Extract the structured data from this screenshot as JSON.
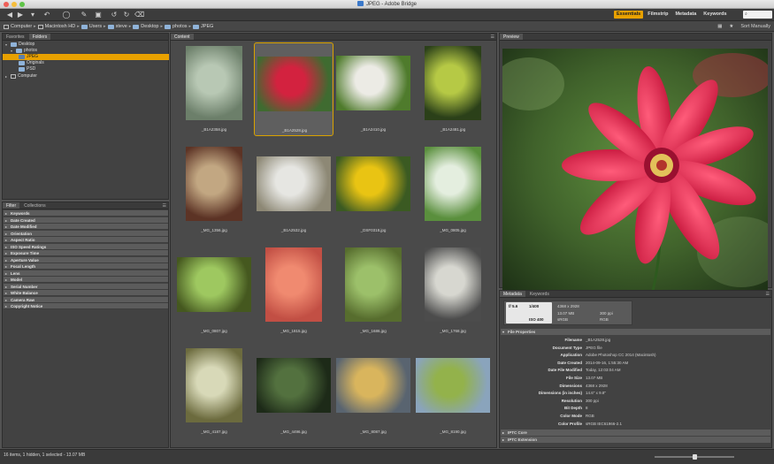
{
  "window": {
    "title": "JPEG - Adobe Bridge"
  },
  "toolbar": {
    "workspaces": [
      "Essentials",
      "Filmstrip",
      "Metadata",
      "Keywords"
    ],
    "search_value": "⌕"
  },
  "path": {
    "crumbs": [
      "Computer",
      "Macintosh HD",
      "Users",
      "steve",
      "Desktop",
      "photos",
      "JPEG"
    ],
    "sort_label": "Sort Manually"
  },
  "left_top_panel": {
    "tabs": [
      "Favorites",
      "Folders"
    ],
    "tree": [
      {
        "label": "Desktop",
        "level": 0
      },
      {
        "label": "photos",
        "level": 1
      },
      {
        "label": "JPEG",
        "level": 2
      },
      {
        "label": "Originals",
        "level": 2
      },
      {
        "label": "PSD",
        "level": 2
      },
      {
        "label": "Computer",
        "level": 0
      }
    ],
    "selected": "JPEG"
  },
  "filter_panel": {
    "tabs": [
      "Filter",
      "Collections"
    ],
    "rows": [
      "Keywords",
      "Date Created",
      "Date Modified",
      "Orientation",
      "Aspect Ratio",
      "ISO Speed Ratings",
      "Exposure Time",
      "Aperture Value",
      "Focal Length",
      "Lens",
      "Model",
      "Serial Number",
      "White Balance",
      "Camera Raw",
      "Copyright Notice"
    ]
  },
  "content_panel": {
    "tab": "Content",
    "thumbnails": [
      {
        "name": "_B1A2358.jpg",
        "colors": [
          "#b8c8b4",
          "#6c7f6a"
        ]
      },
      {
        "name": "_B1A2528.jpg",
        "colors": [
          "#d3223f",
          "#3f6b30"
        ]
      },
      {
        "name": "_B1A2410.jpg",
        "colors": [
          "#ecebe5",
          "#4f7b2c"
        ]
      },
      {
        "name": "_B1A2481.jpg",
        "colors": [
          "#b6c945",
          "#2b4019"
        ]
      },
      {
        "name": "_MG_1356.jpg",
        "colors": [
          "#c2a782",
          "#5c3325"
        ]
      },
      {
        "name": "_B1A2532.jpg",
        "colors": [
          "#e6e6e2",
          "#8d8875"
        ]
      },
      {
        "name": "_DSF0318.jpg",
        "colors": [
          "#e9c413",
          "#3b5a22"
        ]
      },
      {
        "name": "_MG_0805.jpg",
        "colors": [
          "#e4eedf",
          "#5a8f3d"
        ]
      },
      {
        "name": "_MG_0807.jpg",
        "colors": [
          "#9ec860",
          "#45581f"
        ]
      },
      {
        "name": "_MG_1815.jpg",
        "colors": [
          "#f08a70",
          "#c24f44"
        ]
      },
      {
        "name": "_MG_1686.jpg",
        "colors": [
          "#9cc06a",
          "#576d2e"
        ]
      },
      {
        "name": "_MG_1768.jpg",
        "colors": [
          "#d7d7d0",
          "#4c4c4c"
        ]
      },
      {
        "name": "_MG_4187.jpg",
        "colors": [
          "#d8d9b8",
          "#6c6b3e"
        ]
      },
      {
        "name": "_MG_4496.jpg",
        "colors": [
          "#53713f",
          "#1d2a18"
        ]
      },
      {
        "name": "_MG_8087.jpg",
        "colors": [
          "#d9b55d",
          "#596470"
        ]
      },
      {
        "name": "_MG_8190.jpg",
        "colors": [
          "#93b24b",
          "#8aa4bc"
        ]
      }
    ],
    "selected_index": 1
  },
  "preview_panel": {
    "tab": "Preview",
    "filename": "_B1A2528.jpg"
  },
  "metadata_panel": {
    "tabs": [
      "Metadata",
      "Keywords"
    ],
    "camera": {
      "aperture": "f/ 5.6",
      "shutter": "1/400",
      "iso": "ISO 400",
      "dimensions": "4368 x 2928",
      "size": "13.07 MB",
      "resolution": "300 ppi",
      "color_mode": "sRGB",
      "color": "RGB"
    },
    "section_file": "File Properties",
    "properties": [
      {
        "key": "Filename",
        "value": "_B1A2528.jpg"
      },
      {
        "key": "Document Type",
        "value": "JPEG file"
      },
      {
        "key": "Application",
        "value": "Adobe Photoshop CC 2014 (Macintosh)"
      },
      {
        "key": "Date Created",
        "value": "2014-09-16, 1:55:30 AM"
      },
      {
        "key": "Date File Modified",
        "value": "Today, 12:03:04 AM"
      },
      {
        "key": "File Size",
        "value": "13.07 MB"
      },
      {
        "key": "Dimensions",
        "value": "4368 x 2928"
      },
      {
        "key": "Dimensions (in inches)",
        "value": "14.6\" x 9.8\""
      },
      {
        "key": "Resolution",
        "value": "300 ppi"
      },
      {
        "key": "Bit Depth",
        "value": "8"
      },
      {
        "key": "Color Mode",
        "value": "RGB"
      },
      {
        "key": "Color Profile",
        "value": "sRGB IEC61966-2.1"
      }
    ],
    "section_iptc": "IPTC Core",
    "section_iptc_ext": "IPTC Extension"
  },
  "status": {
    "text": "16 items, 1 hidden, 1 selected - 13.07 MB"
  },
  "colors": {
    "accent": "#e8a100",
    "panel_bg": "#424242",
    "chrome_bg": "#535353"
  }
}
